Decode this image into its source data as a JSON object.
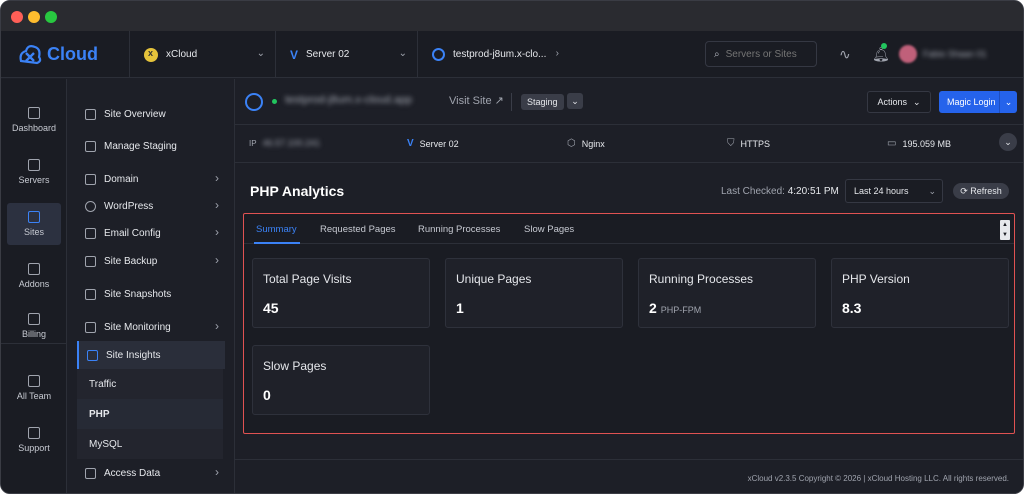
{
  "app": {
    "logo_text": "Cloud"
  },
  "breadcrumbs": [
    {
      "label": "xCloud"
    },
    {
      "label": "Server 02"
    },
    {
      "label": "testprod-j8um.x-clo..."
    }
  ],
  "search": {
    "placeholder": "Servers or Sites"
  },
  "user": {
    "name": "Fabio Shaan 01"
  },
  "rail": [
    {
      "label": "Dashboard",
      "icon": "dashboard-icon"
    },
    {
      "label": "Servers",
      "icon": "servers-icon"
    },
    {
      "label": "Sites",
      "icon": "sites-icon"
    },
    {
      "label": "Addons",
      "icon": "addons-icon"
    },
    {
      "label": "Billing",
      "icon": "billing-icon"
    },
    {
      "label": "All Team",
      "icon": "team-icon"
    },
    {
      "label": "Support",
      "icon": "support-icon"
    }
  ],
  "sidebar": {
    "items": [
      {
        "label": "Site Overview"
      },
      {
        "label": "Manage Staging"
      },
      {
        "label": "Domain"
      },
      {
        "label": "WordPress"
      },
      {
        "label": "Email Config"
      },
      {
        "label": "Site Backup"
      },
      {
        "label": "Site Snapshots"
      },
      {
        "label": "Site Monitoring"
      },
      {
        "label": "Site Insights"
      },
      {
        "label": "Access Data"
      }
    ],
    "sub_items": [
      {
        "label": "Traffic"
      },
      {
        "label": "PHP"
      },
      {
        "label": "MySQL"
      }
    ]
  },
  "site": {
    "url": "testprod-j8um.x-cloud.app",
    "visit_label": "Visit Site ↗",
    "env_badge": "Staging",
    "actions_label": "Actions",
    "magic_login_label": "Magic Login"
  },
  "info": {
    "ip_label": "IP",
    "ip_value": "46.57.100.241",
    "server": "Server 02",
    "web_server": "Nginx",
    "protocol": "HTTPS",
    "disk": "195.059 MB"
  },
  "analytics": {
    "title": "PHP Analytics",
    "last_checked_label": "Last Checked:",
    "last_checked_time": "4:20:51 PM",
    "range": "Last 24 hours",
    "refresh_label": "Refresh",
    "tabs": [
      "Summary",
      "Requested Pages",
      "Running Processes",
      "Slow Pages"
    ],
    "cards": [
      {
        "title": "Total Page Visits",
        "value": "45",
        "unit": ""
      },
      {
        "title": "Unique Pages",
        "value": "1",
        "unit": ""
      },
      {
        "title": "Running Processes",
        "value": "2",
        "unit": "PHP-FPM"
      },
      {
        "title": "PHP Version",
        "value": "8.3",
        "unit": ""
      },
      {
        "title": "Slow Pages",
        "value": "0",
        "unit": ""
      }
    ]
  },
  "footer": {
    "text": "xCloud v2.3.5 Copyright © 2026 | xCloud Hosting LLC. All rights reserved."
  }
}
